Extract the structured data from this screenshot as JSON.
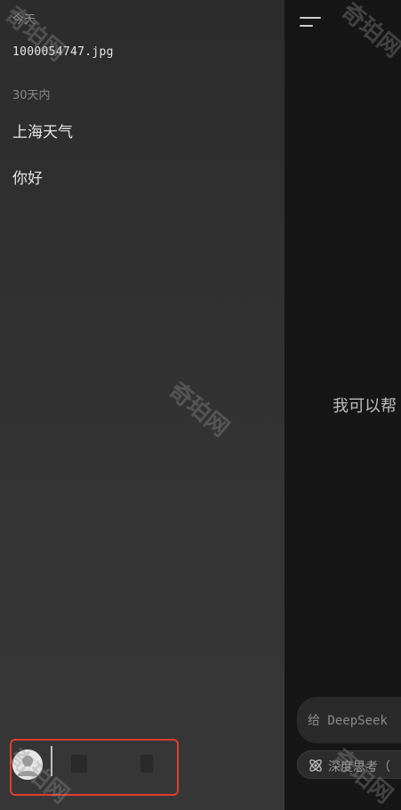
{
  "drawer": {
    "section_today": "今天",
    "today_items": [
      {
        "label": "1000054747.jpg"
      }
    ],
    "section_30_days": "30天内",
    "recent_items": [
      {
        "label": "上海天气"
      },
      {
        "label": "你好"
      }
    ]
  },
  "main": {
    "welcome_text": "我可以帮",
    "input_placeholder": "给 DeepSeek",
    "think_label": "深度思考（"
  },
  "watermark": "奇珀网",
  "colors": {
    "drawer_bg": "#333333",
    "main_bg": "#161616",
    "highlight": "#e53b2f"
  }
}
